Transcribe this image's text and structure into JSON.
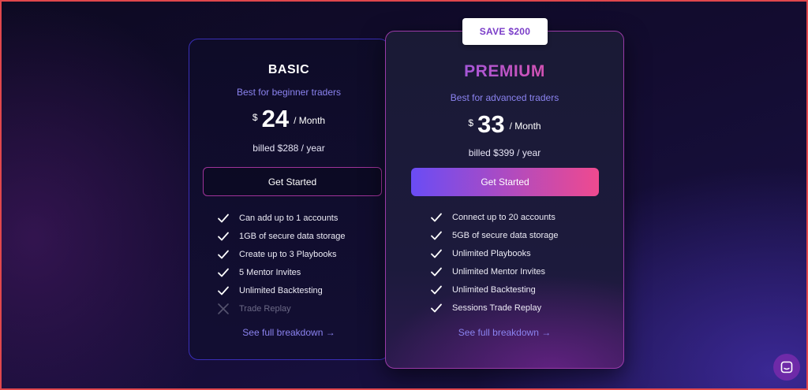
{
  "plans": {
    "basic": {
      "title": "BASIC",
      "subtitle": "Best for beginner traders",
      "currency": "$",
      "amount": "24",
      "period": "/ Month",
      "billed": "billed $288 / year",
      "cta": "Get Started",
      "features": [
        {
          "label": "Can add up to 1 accounts",
          "included": true
        },
        {
          "label": "1GB of secure data storage",
          "included": true
        },
        {
          "label": "Create up to 3 Playbooks",
          "included": true
        },
        {
          "label": "5 Mentor Invites",
          "included": true
        },
        {
          "label": "Unlimited Backtesting",
          "included": true
        },
        {
          "label": "Trade Replay",
          "included": false
        }
      ],
      "link": "See full breakdown →"
    },
    "premium": {
      "badge": "SAVE $200",
      "title": "PREMIUM",
      "subtitle": "Best for advanced traders",
      "currency": "$",
      "amount": "33",
      "period": "/ Month",
      "billed": "billed $399 / year",
      "cta": "Get Started",
      "features": [
        {
          "label": "Connect up to 20 accounts",
          "included": true
        },
        {
          "label": "5GB of secure data storage",
          "included": true
        },
        {
          "label": "Unlimited Playbooks",
          "included": true
        },
        {
          "label": "Unlimited Mentor Invites",
          "included": true
        },
        {
          "label": "Unlimited Backtesting",
          "included": true
        },
        {
          "label": "Sessions Trade Replay",
          "included": true
        }
      ],
      "link": "See full breakdown →"
    }
  },
  "icons": {
    "included": "check-icon",
    "excluded": "cross-icon",
    "chat": "chat-icon"
  },
  "colors": {
    "accent": "#8b83f0",
    "gradient_start": "#6a4cf5",
    "gradient_end": "#ef4a8f",
    "badge_text": "#7a3cc8"
  }
}
